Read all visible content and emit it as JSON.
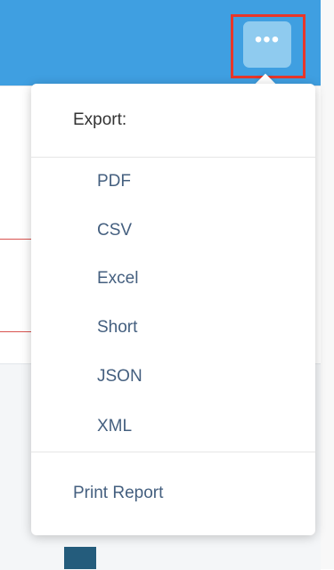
{
  "header": {
    "menu_button_icon": "ellipsis-icon",
    "menu_button_glyph": "•••"
  },
  "export_menu": {
    "title": "Export:",
    "items": [
      {
        "label": "PDF"
      },
      {
        "label": "CSV"
      },
      {
        "label": "Excel"
      },
      {
        "label": "Short"
      },
      {
        "label": "JSON"
      },
      {
        "label": "XML"
      }
    ],
    "print_label": "Print Report"
  },
  "colors": {
    "header": "#3f9fe1",
    "menu_button": "#8fcbef",
    "highlight": "#e8362a",
    "menu_text": "#445f7f"
  }
}
